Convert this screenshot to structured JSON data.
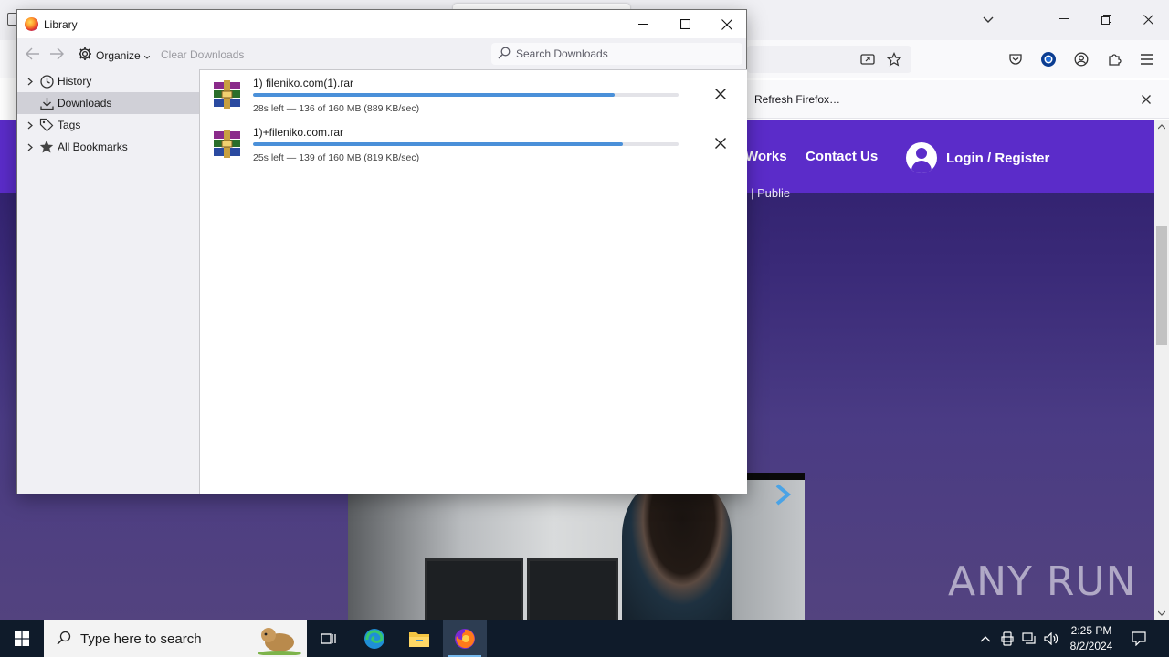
{
  "browser": {
    "notification_button": "Refresh Firefox…"
  },
  "site": {
    "nav_works": "Works",
    "nav_contact": "Contact Us",
    "nav_login": "Login / Register",
    "subtitle_fragment": "| Publie"
  },
  "watermark": "ANY RUN",
  "library": {
    "title": "Library",
    "toolbar": {
      "organize_label": "Organize",
      "clear_downloads_label": "Clear Downloads",
      "search_placeholder": "Search Downloads"
    },
    "sidebar": {
      "items": [
        {
          "label": "History",
          "icon": "history-clock-icon",
          "expandable": true
        },
        {
          "label": "Downloads",
          "icon": "download-icon",
          "expandable": false,
          "selected": true
        },
        {
          "label": "Tags",
          "icon": "tag-icon",
          "expandable": true
        },
        {
          "label": "All Bookmarks",
          "icon": "star-icon",
          "expandable": true
        }
      ]
    },
    "downloads": [
      {
        "name": "1) fileniko.com(1).rar",
        "status": "28s left — 136 of 160 MB (889 KB/sec)",
        "progress": 0.85
      },
      {
        "name": "1)+fileniko.com.rar",
        "status": "25s left — 139 of 160 MB (819 KB/sec)",
        "progress": 0.87
      }
    ]
  },
  "taskbar": {
    "search_placeholder": "Type here to search",
    "time": "2:25 PM",
    "date": "8/2/2024"
  },
  "colors": {
    "site_nav": "#5b2cc9",
    "progress": "#4a90d9",
    "taskbar": "#0f1b2a"
  }
}
